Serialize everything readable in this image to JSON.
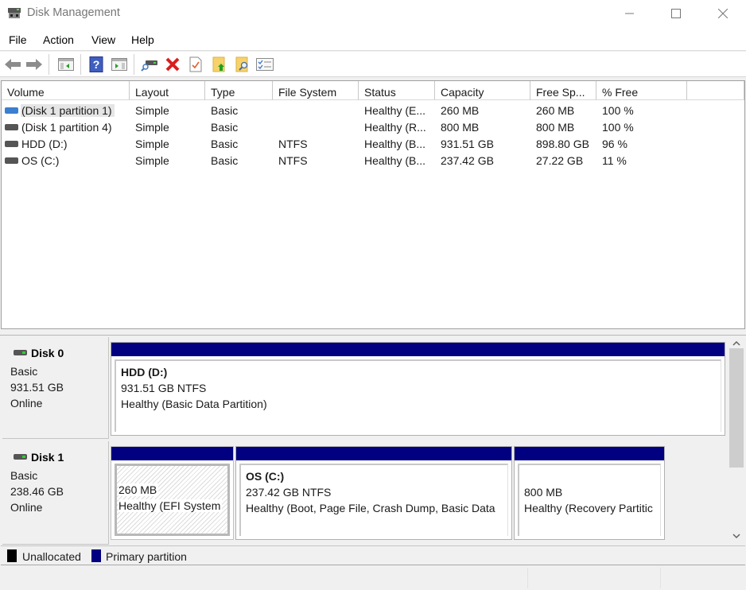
{
  "window": {
    "title": "Disk Management",
    "controls": {
      "minimize": "—",
      "maximize": "☐",
      "close": "✕"
    }
  },
  "menu": [
    "File",
    "Action",
    "View",
    "Help"
  ],
  "toolbar": {
    "buttons": [
      {
        "name": "back",
        "icon": "back-arrow-icon"
      },
      {
        "name": "forward",
        "icon": "forward-arrow-icon"
      },
      {
        "name": "show-hide-console-tree",
        "icon": "console-tree-icon"
      },
      {
        "name": "help",
        "icon": "help-icon",
        "glyph": "?"
      },
      {
        "name": "show-hide-action-pane",
        "icon": "action-pane-icon"
      },
      {
        "name": "connect-virtual-disk",
        "icon": "disk-connect-icon"
      },
      {
        "name": "delete",
        "icon": "delete-icon",
        "glyph": "✖"
      },
      {
        "name": "properties",
        "icon": "properties-icon"
      },
      {
        "name": "open-folder",
        "icon": "folder-up-icon"
      },
      {
        "name": "explore",
        "icon": "folder-search-icon"
      },
      {
        "name": "list-view",
        "icon": "checklist-icon"
      }
    ]
  },
  "volume_table": {
    "columns": [
      "Volume",
      "Layout",
      "Type",
      "File System",
      "Status",
      "Capacity",
      "Free Sp...",
      "% Free"
    ],
    "rows": [
      {
        "volume": "(Disk 1 partition 1)",
        "layout": "Simple",
        "type": "Basic",
        "fs": "",
        "status": "Healthy (E...",
        "capacity": "260 MB",
        "free": "260 MB",
        "pct": "100 %",
        "selected": true,
        "icon_color": "#3a7fd0"
      },
      {
        "volume": "(Disk 1 partition 4)",
        "layout": "Simple",
        "type": "Basic",
        "fs": "",
        "status": "Healthy (R...",
        "capacity": "800 MB",
        "free": "800 MB",
        "pct": "100 %",
        "selected": false,
        "icon_color": "#555555"
      },
      {
        "volume": "HDD (D:)",
        "layout": "Simple",
        "type": "Basic",
        "fs": "NTFS",
        "status": "Healthy (B...",
        "capacity": "931.51 GB",
        "free": "898.80 GB",
        "pct": "96 %",
        "selected": false,
        "icon_color": "#555555"
      },
      {
        "volume": "OS (C:)",
        "layout": "Simple",
        "type": "Basic",
        "fs": "NTFS",
        "status": "Healthy (B...",
        "capacity": "237.42 GB",
        "free": "27.22 GB",
        "pct": "11 %",
        "selected": false,
        "icon_color": "#555555"
      }
    ]
  },
  "disks": [
    {
      "name": "Disk 0",
      "type": "Basic",
      "size": "931.51 GB",
      "state": "Online",
      "partitions": [
        {
          "label": "HDD  (D:)",
          "size": "931.51 GB NTFS",
          "status": "Healthy (Basic Data Partition)",
          "selected": false
        }
      ]
    },
    {
      "name": "Disk 1",
      "type": "Basic",
      "size": "238.46 GB",
      "state": "Online",
      "partitions": [
        {
          "label": "",
          "size": "260 MB",
          "status": "Healthy (EFI System",
          "selected": true
        },
        {
          "label": "OS  (C:)",
          "size": "237.42 GB NTFS",
          "status": "Healthy (Boot, Page File, Crash Dump, Basic Data",
          "selected": false
        },
        {
          "label": "",
          "size": "800 MB",
          "status": "Healthy (Recovery Partitic",
          "selected": false
        }
      ]
    }
  ],
  "legend": [
    {
      "label": "Unallocated",
      "color": "#000000"
    },
    {
      "label": "Primary partition",
      "color": "#000080"
    }
  ],
  "colors": {
    "partition_bar": "#000080",
    "selection_row": "#e5e5e5"
  }
}
